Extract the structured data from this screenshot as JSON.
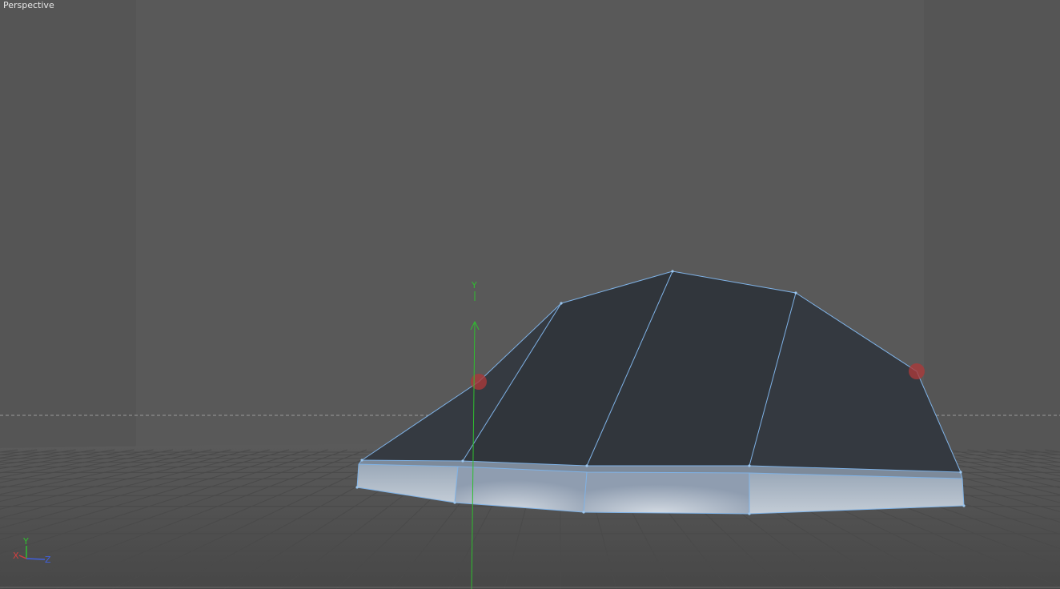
{
  "viewport": {
    "camera_label": "Perspective",
    "gizmo_axis_label": "Y"
  },
  "axis_indicator": {
    "x_label": "X",
    "y_label": "Y",
    "z_label": "Z"
  },
  "colors": {
    "background": "#555555",
    "grid_line": "#4b4b4b",
    "object_edge": "#7fb2e6",
    "object_face_dark": "#32363c",
    "object_face_light": "#aab6c4",
    "y_axis": "#2fbf2f",
    "x_axis": "#d04040",
    "z_axis": "#4060e0",
    "handle": "#a93a3a"
  }
}
